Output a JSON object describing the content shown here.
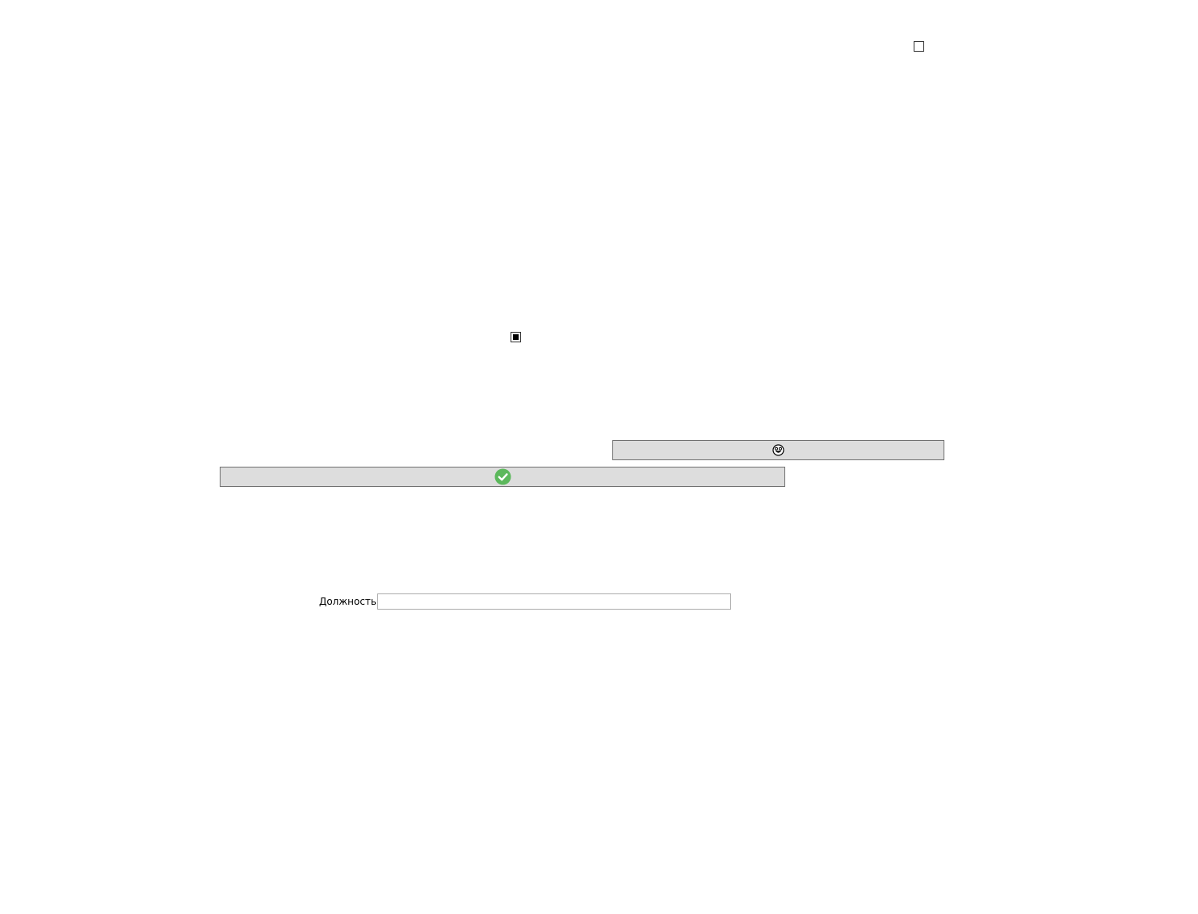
{
  "window": {
    "checkbox_top_state": "unchecked",
    "checkbox_middle_state": "indeterminate"
  },
  "buttons": {
    "emoji_button_icon": "smiling-face-icon",
    "ok_button_icon": "green-checkmark-icon",
    "ok_button_color": "#5cb85c"
  },
  "form": {
    "position_label": "Должность",
    "position_value": "",
    "position_placeholder": ""
  }
}
